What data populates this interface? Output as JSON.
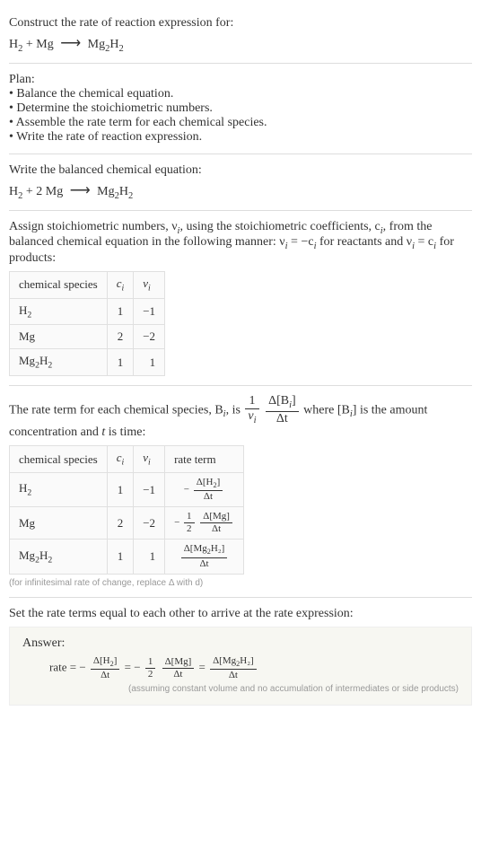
{
  "prompt": {
    "line1": "Construct the rate of reaction expression for:",
    "eq_lhs_a": "H",
    "eq_lhs_a_sub": "2",
    "plus": " + Mg ",
    "arrow": "⟶",
    "eq_rhs_a": " Mg",
    "eq_rhs_a_sub": "2",
    "eq_rhs_b": "H",
    "eq_rhs_b_sub": "2"
  },
  "plan": {
    "header": "Plan:",
    "b1": "• Balance the chemical equation.",
    "b2": "• Determine the stoichiometric numbers.",
    "b3": "• Assemble the rate term for each chemical species.",
    "b4": "• Write the rate of reaction expression."
  },
  "balanced": {
    "lead": "Write the balanced chemical equation:",
    "lhs_a": "H",
    "lhs_a_sub": "2",
    "plus": " + 2 Mg ",
    "arrow": "⟶",
    "rhs_a": " Mg",
    "rhs_a_sub": "2",
    "rhs_b": "H",
    "rhs_b_sub": "2"
  },
  "assign": {
    "text_a": "Assign stoichiometric numbers, ν",
    "text_b": ", using the stoichiometric coefficients, c",
    "text_c": ", from the balanced chemical equation in the following manner: ν",
    "text_d": " = −c",
    "text_e": " for reactants and ν",
    "text_f": " = c",
    "text_g": " for products:",
    "i": "i",
    "table": {
      "h1": "chemical species",
      "h2": "c",
      "h3": "ν",
      "rows": [
        {
          "sp_a": "H",
          "sp_a_sub": "2",
          "sp_b": "",
          "sp_b_sub": "",
          "c": "1",
          "nu": "−1"
        },
        {
          "sp_a": "Mg",
          "sp_a_sub": "",
          "sp_b": "",
          "sp_b_sub": "",
          "c": "2",
          "nu": "−2"
        },
        {
          "sp_a": "Mg",
          "sp_a_sub": "2",
          "sp_b": "H",
          "sp_b_sub": "2",
          "c": "1",
          "nu": "1"
        }
      ]
    }
  },
  "rateterm": {
    "text_a": "The rate term for each chemical species, B",
    "text_b": ", is ",
    "one": "1",
    "nu": "ν",
    "dB_a": "Δ[B",
    "dB_b": "]",
    "dt": "Δt",
    "text_c": " where [B",
    "text_d": "] is the amount concentration and ",
    "tvar": "t",
    "text_e": " is time:",
    "i": "i",
    "table": {
      "h1": "chemical species",
      "h2": "c",
      "h3": "ν",
      "h4": "rate term",
      "rows": [
        {
          "sp_a": "H",
          "sp_a_sub": "2",
          "sp_b": "",
          "sp_b_sub": "",
          "c": "1",
          "nu": "−1",
          "rt_neg": "− ",
          "rt_coef_num": "",
          "rt_coef_den": "",
          "rt_num_a": "Δ[H",
          "rt_num_a_sub": "2",
          "rt_num_b": "]",
          "rt_den": "Δt"
        },
        {
          "sp_a": "Mg",
          "sp_a_sub": "",
          "sp_b": "",
          "sp_b_sub": "",
          "c": "2",
          "nu": "−2",
          "rt_neg": "− ",
          "rt_coef_num": "1",
          "rt_coef_den": "2",
          "rt_num_a": "Δ[Mg]",
          "rt_num_a_sub": "",
          "rt_num_b": "",
          "rt_den": "Δt"
        },
        {
          "sp_a": "Mg",
          "sp_a_sub": "2",
          "sp_b": "H",
          "sp_b_sub": "2",
          "c": "1",
          "nu": "1",
          "rt_neg": "",
          "rt_coef_num": "",
          "rt_coef_den": "",
          "rt_num_a": "Δ[Mg",
          "rt_num_a_sub": "2",
          "rt_num_b": "H₂]",
          "rt_den": "Δt"
        }
      ]
    },
    "note": "(for infinitesimal rate of change, replace Δ with d)"
  },
  "final": {
    "lead": "Set the rate terms equal to each other to arrive at the rate expression:"
  },
  "answer": {
    "label": "Answer:",
    "rate": "rate = ",
    "neg": "− ",
    "t1_num_a": "Δ[H",
    "t1_num_sub": "2",
    "t1_num_b": "]",
    "dt": "Δt",
    "eq": " = ",
    "coef_num": "1",
    "coef_den": "2",
    "t2_num": "Δ[Mg]",
    "t3_num_a": "Δ[Mg",
    "t3_num_sub": "2",
    "t3_num_b": "H₂]",
    "note": "(assuming constant volume and no accumulation of intermediates or side products)"
  }
}
